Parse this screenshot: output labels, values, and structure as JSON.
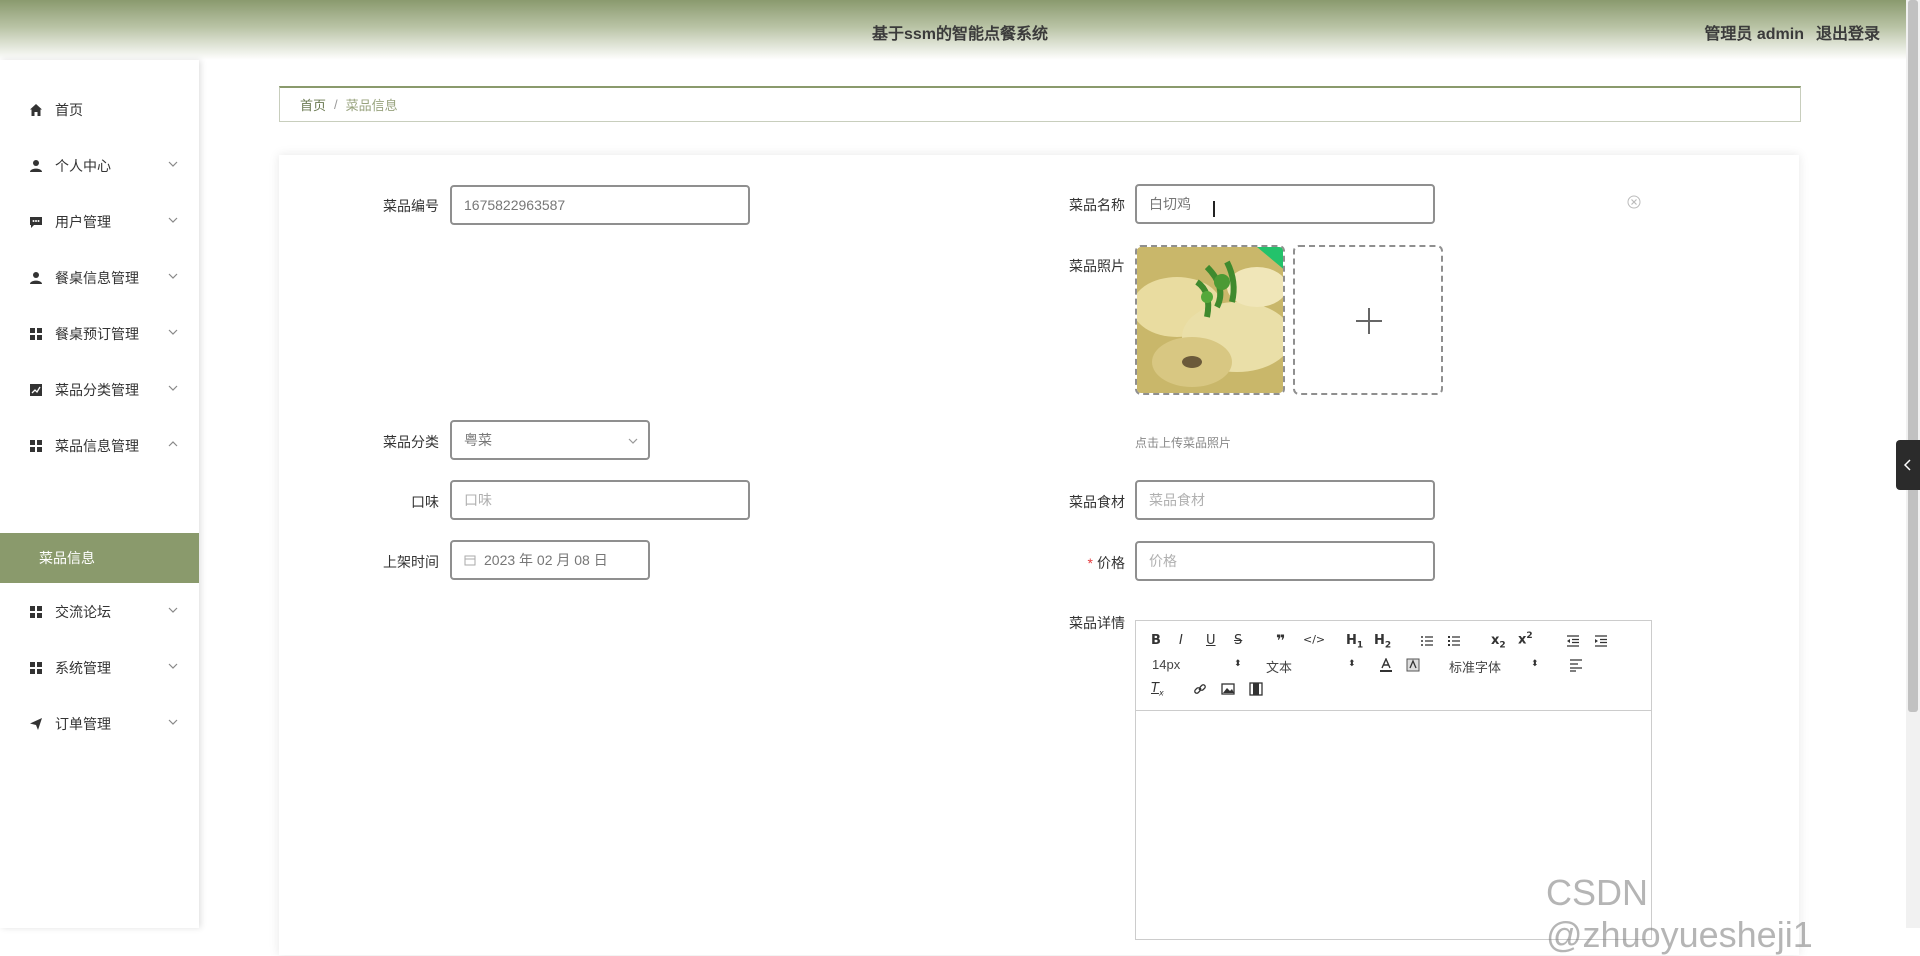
{
  "header": {
    "title": "基于ssm的智能点餐系统",
    "user_label": "管理员 admin",
    "logout_label": "退出登录"
  },
  "sidebar": {
    "items": [
      {
        "label": "首页",
        "icon": "home-icon"
      },
      {
        "label": "个人中心",
        "icon": "user-icon"
      },
      {
        "label": "用户管理",
        "icon": "chat-icon"
      },
      {
        "label": "餐桌信息管理",
        "icon": "user-icon"
      },
      {
        "label": "餐桌预订管理",
        "icon": "grid-icon"
      },
      {
        "label": "菜品分类管理",
        "icon": "chart-icon"
      },
      {
        "label": "菜品信息管理",
        "icon": "grid-icon"
      },
      {
        "label": "交流论坛",
        "icon": "grid-icon"
      },
      {
        "label": "系统管理",
        "icon": "grid-icon"
      },
      {
        "label": "订单管理",
        "icon": "send-icon"
      }
    ],
    "active_sub": "菜品信息"
  },
  "breadcrumb": {
    "home": "首页",
    "separator": "/",
    "current": "菜品信息"
  },
  "form": {
    "dish_no_label": "菜品编号",
    "dish_no_value": "1675822963587",
    "dish_name_label": "菜品名称",
    "dish_name_value": "白切鸡",
    "photo_label": "菜品照片",
    "upload_hint": "点击上传菜品照片",
    "category_label": "菜品分类",
    "category_value": "粤菜",
    "taste_label": "口味",
    "taste_placeholder": "口味",
    "ingredients_label": "菜品食材",
    "ingredients_placeholder": "菜品食材",
    "shelf_time_label": "上架时间",
    "shelf_time_value": "2023 年 02 月 08 日",
    "price_label": "价格",
    "price_required": "*",
    "price_placeholder": "价格",
    "details_label": "菜品详情"
  },
  "editor": {
    "font_size": "14px",
    "text_style": "文本",
    "font_family": "标准字体"
  },
  "watermark": "CSDN @zhuoyuesheji1"
}
